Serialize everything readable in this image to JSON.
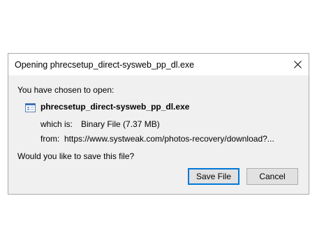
{
  "dialog": {
    "title": "Opening phrecsetup_direct-sysweb_pp_dl.exe",
    "close_icon": "close-icon",
    "intro": "You have chosen to open:",
    "file_icon": "file-icon",
    "filename": "phrecsetup_direct-sysweb_pp_dl.exe",
    "which_is_label": "which is:",
    "which_is_value": "Binary File (7.37 MB)",
    "from_label": "from:",
    "from_value": "https://www.systweak.com/photos-recovery/download?...",
    "question": "Would you like to save this file?",
    "save_label": "Save File",
    "cancel_label": "Cancel",
    "accent_color": "#0078d7"
  }
}
